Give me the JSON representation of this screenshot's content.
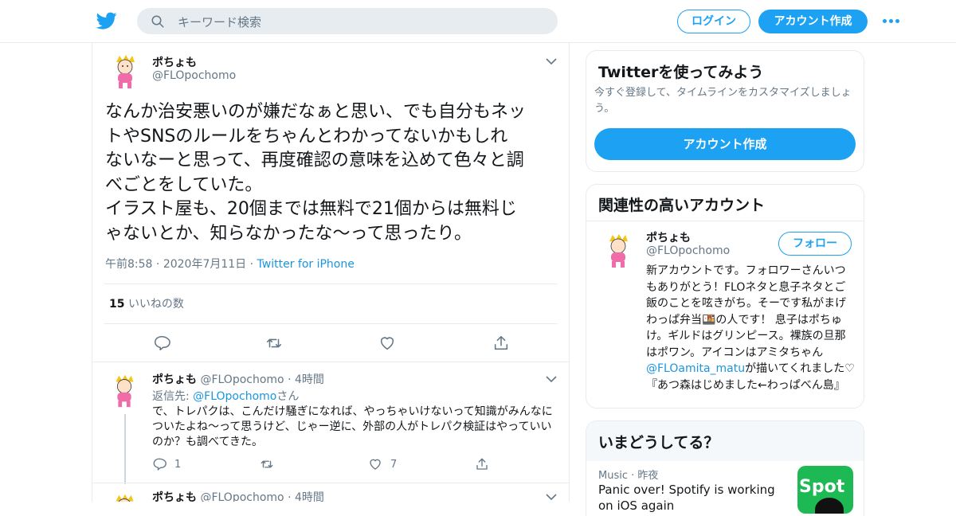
{
  "header": {
    "search_placeholder": "キーワード検索",
    "login_label": "ログイン",
    "create_account_label": "アカウント作成"
  },
  "tweet": {
    "display_name": "ポちょも",
    "handle": "@FLOpochomo",
    "text_lines": [
      "なんか治安悪いのが嫌だなぁと思い、でも自分もネッ",
      "トやSNSのルールをちゃんとわかってないかもしれ",
      "ないなーと思って、再度確認の意味を込めて色々と調",
      "べごとをしていた。",
      "イラスト屋も、20個までは無料で21個からは無料じ",
      "ゃないとか、知らなかったな〜って思ったり。"
    ],
    "time": "午前8:58",
    "date": "2020年7月11日",
    "source": "Twitter for iPhone",
    "likes_count": "15",
    "likes_label": "いいねの数"
  },
  "replies": [
    {
      "display_name": "ポちょも",
      "handle": "@FLOpochomo",
      "time": "4時間",
      "reply_prefix": "返信先: ",
      "reply_handle": "@FLOpochomo",
      "reply_suffix": "さん",
      "text": "で、トレパクは、こんだけ騒ぎになれば、やっちゃいけないって知識がみんなについたよね〜って思うけど、じゃー逆に、外部の人がトレパク検証はやっていいのか？も調べてきた。",
      "reply_count": "1",
      "like_count": "7"
    },
    {
      "display_name": "ポちょも",
      "handle": "@FLOpochomo",
      "time": "4時間"
    }
  ],
  "signup_card": {
    "title": "Twitterを使ってみよう",
    "description": "今すぐ登録して、タイムラインをカスタマイズしましょう。",
    "button_label": "アカウント作成"
  },
  "related_card": {
    "title": "関連性の高いアカウント",
    "display_name": "ポちょも",
    "handle": "@FLOpochomo",
    "follow_label": "フォロー",
    "bio_before": "新アカウントです。フォロワーさんいつもありがとう！FLOネタと息子ネタとご飯のことを呟きがち。そーです私がまげわっぱ弁当🍱の人です！ 息子はポちゅけ。ギルドはグリンピース。裸族の旦那はポワン。アイコンはアミタちゃん",
    "bio_link": "@FLOamita_matu",
    "bio_after": "が描いてくれました♡『あつ森はじめました←わっぱべん島』"
  },
  "trends_card": {
    "title": "いまどうしてる？",
    "category": "Music",
    "when": "昨夜",
    "headline": "Panic over! Spotify is working on iOS again",
    "image_text": "Spot"
  },
  "colors": {
    "accent": "#1da1f2",
    "link": "#1b95e0",
    "muted": "#657786",
    "border": "#e6ecf0"
  }
}
